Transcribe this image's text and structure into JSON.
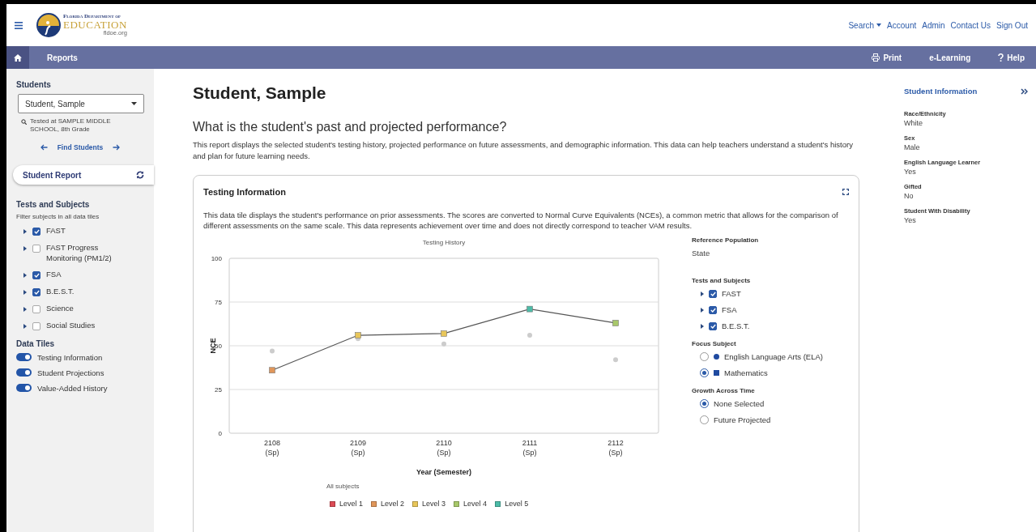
{
  "header": {
    "logo": {
      "line1": "Florida Department of",
      "line2": "EDUCATION",
      "line3": "fldoe.org"
    },
    "links": [
      {
        "label": "Search",
        "dropdown": true
      },
      {
        "label": "Account",
        "dropdown": false
      },
      {
        "label": "Admin",
        "dropdown": false
      },
      {
        "label": "Contact Us",
        "dropdown": false
      },
      {
        "label": "Sign Out",
        "dropdown": false
      }
    ]
  },
  "navbar": {
    "left": [
      {
        "kind": "home"
      },
      {
        "kind": "text",
        "label": "Reports"
      }
    ],
    "right": [
      {
        "kind": "print",
        "label": "Print"
      },
      {
        "kind": "text",
        "label": "e-Learning"
      },
      {
        "kind": "help",
        "label": "Help"
      }
    ]
  },
  "sidebar": {
    "students_heading": "Students",
    "student_select": "Student, Sample",
    "tested_at": "Tested at SAMPLE MIDDLE SCHOOL, 8th Grade",
    "find_students": "Find Students",
    "report": "Student Report",
    "tests_heading": "Tests and Subjects",
    "tests_hint": "Filter subjects in all data tiles",
    "tests": [
      {
        "label": "FAST",
        "checked": true,
        "expanded": false
      },
      {
        "label": "FAST Progress Monitoring (PM1/2)",
        "checked": false,
        "expanded": false
      },
      {
        "label": "FSA",
        "checked": true,
        "expanded": false
      },
      {
        "label": "B.E.S.T.",
        "checked": true,
        "expanded": false
      },
      {
        "label": "Science",
        "checked": false,
        "expanded": false
      },
      {
        "label": "Social Studies",
        "checked": false,
        "expanded": false
      }
    ],
    "tiles_heading": "Data Tiles",
    "tiles": [
      {
        "label": "Testing Information",
        "on": true
      },
      {
        "label": "Student Projections",
        "on": true
      },
      {
        "label": "Value-Added History",
        "on": true
      }
    ]
  },
  "main": {
    "title": "Student, Sample",
    "question": "What is the student's past and projected performance?",
    "description": "This report displays the selected student's testing history, projected performance on future assessments, and demographic information. This data can help teachers understand a student's history and plan for future learning needs.",
    "card": {
      "title": "Testing Information",
      "description": "This data tile displays the student's performance on prior assessments. The scores are converted to Normal Curve Equivalents (NCEs), a common metric that allows for the comparison of different assessments on the same scale. This data represents achievement over time and does not directly correspond to teacher VAM results.",
      "chart_data": {
        "type": "line",
        "title": "Testing History",
        "xlabel": "Year (Semester)",
        "ylabel": "NCE",
        "categories": [
          "2108 (Sp)",
          "2109 (Sp)",
          "2110 (Sp)",
          "2111 (Sp)",
          "2112 (Sp)"
        ],
        "ylim": [
          0,
          100
        ],
        "yticks": [
          0,
          25,
          50,
          75,
          100
        ],
        "grid": true,
        "series": [
          {
            "type": "line",
            "marker": "square",
            "color": "#555555",
            "values": [
              36,
              56,
              57,
              71,
              63
            ]
          },
          {
            "type": "scatter",
            "color": "#cccccc",
            "values": [
              47,
              54,
              51,
              56,
              42
            ]
          }
        ]
      },
      "point_markers": [
        {
          "color": "#e0965a"
        },
        {
          "color": "#e8c65a"
        },
        {
          "color": "#e8c65a"
        },
        {
          "color": "#4cbca8"
        },
        {
          "color": "#a8c86a"
        }
      ],
      "legend_title": "All subjects",
      "legend": [
        {
          "label": "Level 1",
          "color": "#dd4b55"
        },
        {
          "label": "Level 2",
          "color": "#e0965a"
        },
        {
          "label": "Level 3",
          "color": "#e8c65a"
        },
        {
          "label": "Level 4",
          "color": "#a8c86a"
        },
        {
          "label": "Level 5",
          "color": "#4cbca8"
        }
      ],
      "reference_heading": "Reference Population",
      "reference_value": "State",
      "tests_heading": "Tests and Subjects",
      "tests": [
        {
          "label": "FAST",
          "checked": true,
          "expanded": false
        },
        {
          "label": "FSA",
          "checked": true,
          "expanded": false
        },
        {
          "label": "B.E.S.T.",
          "checked": true,
          "expanded": false
        }
      ],
      "focus_heading": "Focus Subject",
      "focus": [
        {
          "label": "English Language Arts (ELA)",
          "selected": false,
          "kind": "circle"
        },
        {
          "label": "Mathematics",
          "selected": true,
          "kind": "square"
        }
      ],
      "growth_heading": "Growth Across Time",
      "growth": [
        {
          "label": "None Selected",
          "selected": true
        },
        {
          "label": "Future Projected",
          "selected": false
        }
      ]
    }
  },
  "info_panel": {
    "title": "Student Information",
    "fields": [
      {
        "label": "Race/Ethnicity",
        "value": "White"
      },
      {
        "label": "Sex",
        "value": "Male"
      },
      {
        "label": "English Language Learner",
        "value": "Yes"
      },
      {
        "label": "Gifted",
        "value": "No"
      },
      {
        "label": "Student With Disability",
        "value": "Yes"
      }
    ]
  }
}
